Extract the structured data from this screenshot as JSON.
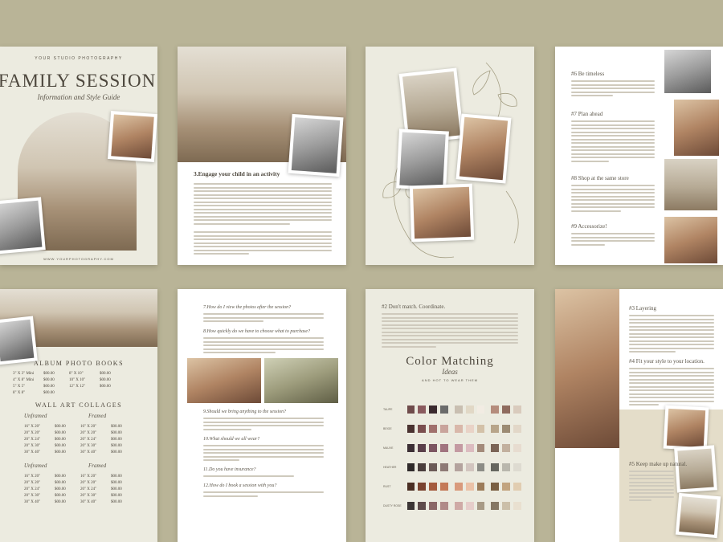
{
  "p1": {
    "studio": "YOUR STUDIO PHOTOGRAPHY",
    "title": "FAMILY SESSION",
    "subtitle": "Information and Style Guide",
    "url": "WWW.YOURPHOTOGRAPHY.COM"
  },
  "p2": {
    "heading": "3.Engage your child in an activity"
  },
  "p4": {
    "h6": "#6 Be timeless",
    "h7": "#7 Plan ahead",
    "h8": "#8 Shop at the same store",
    "h9": "#9 Accessorize!"
  },
  "p5": {
    "album_title": "ALBUM PHOTO BOOKS",
    "album_rows": [
      {
        "size": "3\" X 3\" Mini",
        "price": "$00.00",
        "size2": "8\" X 10\"",
        "price2": "$00.00"
      },
      {
        "size": "4\" X 8\" Mini",
        "price": "$00.00",
        "size2": "10\" X 10\"",
        "price2": "$00.00"
      },
      {
        "size": "5\" X 5\"",
        "price": "$00.00",
        "size2": "12\" X 12\"",
        "price2": "$00.00"
      },
      {
        "size": "8\" X 8\"",
        "price": "$00.00",
        "size2": "",
        "price2": ""
      }
    ],
    "wall_title": "WALL ART COLLAGES",
    "unframed": "Unframed",
    "framed": "Framed",
    "wall_rows_a": [
      {
        "size": "16\" X 20\"",
        "price": "$00.00",
        "size2": "16\" X 20\"",
        "price2": "$00.00"
      },
      {
        "size": "20\" X 20\"",
        "price": "$00.00",
        "size2": "20\" X 20\"",
        "price2": "$00.00"
      },
      {
        "size": "20\" X 24\"",
        "price": "$00.00",
        "size2": "20\" X 24\"",
        "price2": "$00.00"
      },
      {
        "size": "20\" X 30\"",
        "price": "$00.00",
        "size2": "20\" X 30\"",
        "price2": "$00.00"
      },
      {
        "size": "30\" X 40\"",
        "price": "$00.00",
        "size2": "30\" X 40\"",
        "price2": "$00.00"
      }
    ],
    "wall_rows_b": [
      {
        "size": "16\" X 20\"",
        "price": "$00.00",
        "size2": "16\" X 20\"",
        "price2": "$00.00"
      },
      {
        "size": "20\" X 20\"",
        "price": "$00.00",
        "size2": "20\" X 20\"",
        "price2": "$00.00"
      },
      {
        "size": "20\" X 24\"",
        "price": "$00.00",
        "size2": "20\" X 24\"",
        "price2": "$00.00"
      },
      {
        "size": "20\" X 30\"",
        "price": "$00.00",
        "size2": "20\" X 30\"",
        "price2": "$00.00"
      },
      {
        "size": "30\" X 40\"",
        "price": "$00.00",
        "size2": "30\" X 40\"",
        "price2": "$00.00"
      }
    ]
  },
  "p6": {
    "q7": "7.How do I view the photos after the session?",
    "q8": "8.How quickly do we have to choose what to purchase?",
    "q9": "9.Should we bring anything to the session?",
    "q10": "10.What should we all wear?",
    "q11": "11.Do you have insurance?",
    "q12": "12.How do I book a session with you?"
  },
  "p7": {
    "h2": "#2 Don't match. Coordinate.",
    "title": "Color Matching",
    "title_script": "Ideas",
    "subtitle": "AND HOT TO WEAR THEM",
    "rows": [
      "TAUPE",
      "BEIGE",
      "MAUVE",
      "HEATHER",
      "RUST",
      "DUSTY ROSE"
    ],
    "palette": [
      [
        "#6f4b4b",
        "#8a5a5e",
        "#3a2a2e",
        "#6b6b6b",
        "#c9bfb1",
        "#e1d8c6",
        "#f2ece3",
        "#b58c7c",
        "#8f6b5e",
        "#d9cbbd"
      ],
      [
        "#4a3230",
        "#7a4e4e",
        "#a0706c",
        "#c9a49c",
        "#d9b8aa",
        "#e9d3c7",
        "#d3c1a8",
        "#b8a58a",
        "#9c8b73",
        "#e2d7c8"
      ],
      [
        "#3c2f35",
        "#5a3f4a",
        "#7c5561",
        "#a1747f",
        "#c49aa2",
        "#dcbcc0",
        "#a38a7a",
        "#7b6456",
        "#c2b09e",
        "#e7dcd0"
      ],
      [
        "#2f2a2a",
        "#4a3e3c",
        "#6b5a57",
        "#8e7a76",
        "#b4a39e",
        "#d2c5bf",
        "#8c8c86",
        "#66665f",
        "#b9b7ad",
        "#dedbd1"
      ],
      [
        "#4a2e23",
        "#7a4330",
        "#a45b3e",
        "#c47a58",
        "#d99a7c",
        "#ebc2a8",
        "#9c7c5a",
        "#7a5f42",
        "#c2a47f",
        "#e1cdb1"
      ],
      [
        "#3b3535",
        "#5e4b4b",
        "#8a6767",
        "#b08a88",
        "#cfaaa6",
        "#e6cdca",
        "#a89a86",
        "#857764",
        "#cbbfa9",
        "#e9e0d0"
      ]
    ]
  },
  "p8": {
    "h3": "#3 Layering",
    "h4": "#4 Fit your style to your location.",
    "h5": "#5 Keep make up natural."
  },
  "colors": {
    "background": "#b9b497",
    "beige_page": "#ecebe0",
    "text": "#5a5448"
  }
}
